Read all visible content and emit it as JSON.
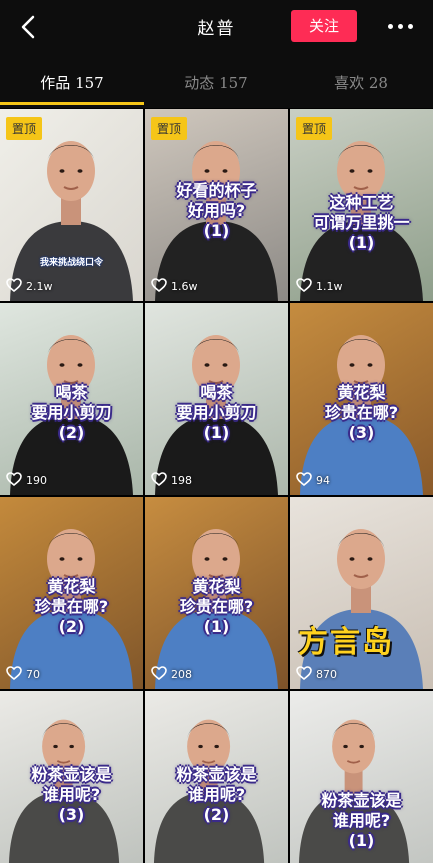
{
  "header": {
    "title": "赵普",
    "follow_label": "关注"
  },
  "tabs": [
    {
      "label": "作品 157",
      "active": true
    },
    {
      "label": "动态 157",
      "active": false
    },
    {
      "label": "喜欢 28",
      "active": false
    }
  ],
  "colors": {
    "accent": "#fe2c55",
    "pin": "#f5c518"
  },
  "videos": [
    {
      "pinned": true,
      "pin_label": "置顶",
      "caption": "",
      "sub_caption": "我来挑战绕口令",
      "likes": "2.1w"
    },
    {
      "pinned": true,
      "pin_label": "置顶",
      "caption": "好看的杯子\n好用吗?\n(1)",
      "likes": "1.6w"
    },
    {
      "pinned": true,
      "pin_label": "置顶",
      "caption": "这种工艺\n可谓万里挑一\n(1)",
      "likes": "1.1w"
    },
    {
      "pinned": false,
      "caption": "喝茶\n要用小剪刀\n(2)",
      "likes": "190"
    },
    {
      "pinned": false,
      "caption": "喝茶\n要用小剪刀\n(1)",
      "likes": "198"
    },
    {
      "pinned": false,
      "caption": "黄花梨\n珍贵在哪?\n(3)",
      "likes": "94"
    },
    {
      "pinned": false,
      "caption": "黄花梨\n珍贵在哪?\n(2)",
      "likes": "70"
    },
    {
      "pinned": false,
      "caption": "黄花梨\n珍贵在哪?\n(1)",
      "likes": "208"
    },
    {
      "pinned": false,
      "caption": "",
      "brand": "方言岛",
      "likes": "870"
    },
    {
      "pinned": false,
      "caption": "粉茶壶该是\n谁用呢?\n(3)",
      "likes": ""
    },
    {
      "pinned": false,
      "caption": "粉茶壶该是\n谁用呢?\n(2)",
      "likes": ""
    },
    {
      "pinned": false,
      "caption": "粉茶壶该是\n谁用呢?\n(1)",
      "likes": ""
    }
  ]
}
